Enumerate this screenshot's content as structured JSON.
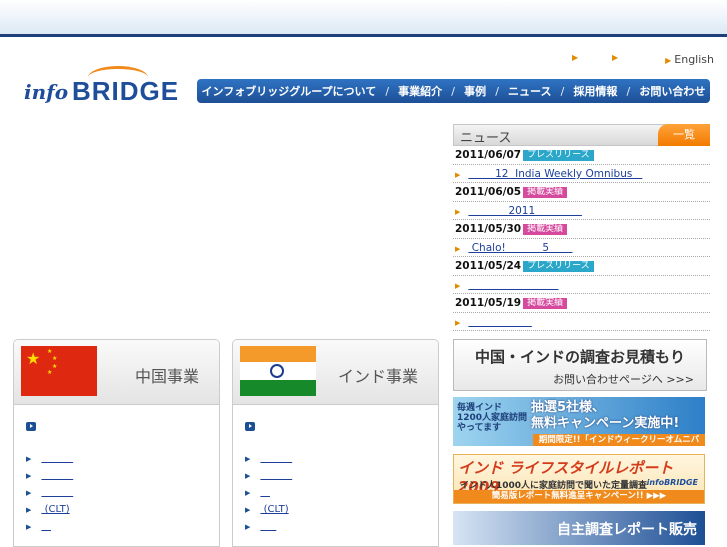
{
  "header": {
    "logo_text_info": "info",
    "logo_text_bridge": "BRIDGE",
    "util_link": "English"
  },
  "gnav": {
    "items": [
      "インフォブリッジグループについて",
      "事業紹介",
      "事例",
      "ニュース",
      "採用情報",
      "お問い合わせ"
    ],
    "separator": "/"
  },
  "news": {
    "title": "ニュース",
    "all_label": "一覧",
    "items": [
      {
        "date": "2011/06/07",
        "tag": "プレスリリース",
        "tag_type": "press",
        "link": "        12  India Weekly Omnibus   "
      },
      {
        "date": "2011/06/05",
        "tag": "掲載実績",
        "tag_type": "media",
        "link": "            2011              "
      },
      {
        "date": "2011/05/30",
        "tag": "掲載実績",
        "tag_type": "media",
        "link": " Chalo!           5       "
      },
      {
        "date": "2011/05/24",
        "tag": "プレスリリース",
        "tag_type": "press",
        "link": "                           "
      },
      {
        "date": "2011/05/19",
        "tag": "掲載実績",
        "tag_type": "media",
        "link": "                   "
      }
    ]
  },
  "china_panel": {
    "title": "中国事業",
    "links": [
      "          ",
      "          ",
      "          ",
      " (CLT)",
      "   "
    ]
  },
  "india_panel": {
    "title": "インド事業",
    "links": [
      "          ",
      "          ",
      "   ",
      " (CLT)",
      "     "
    ]
  },
  "side": {
    "estimate_title": "中国・インドの調査お見積もり",
    "estimate_sub": "お問い合わせページへ >>>",
    "banner1_a": "毎週インド\n1200人家庭訪問\nやってます",
    "banner1_b": "抽選5社様、\n無料キャンペーン実施中!",
    "banner1_c": "期間限定!!「インドウィークリーオムニバス」",
    "banner2_a": "インド ライフスタイルレポート2009",
    "banner2_b": "インド人1000人に家庭訪問で聞いた定量調査",
    "banner2_logo": "infoBRIDGE",
    "banner2_c": "簡易版レポート無料進呈キャンペーン!! ▶▶▶",
    "banner3_a": "自主調査レポート販売"
  },
  "colors": {
    "nav_blue": "#1d4f95",
    "accent_orange": "#f08a1c",
    "press_tag": "#2aa7c9",
    "media_tag": "#d64a9e"
  }
}
